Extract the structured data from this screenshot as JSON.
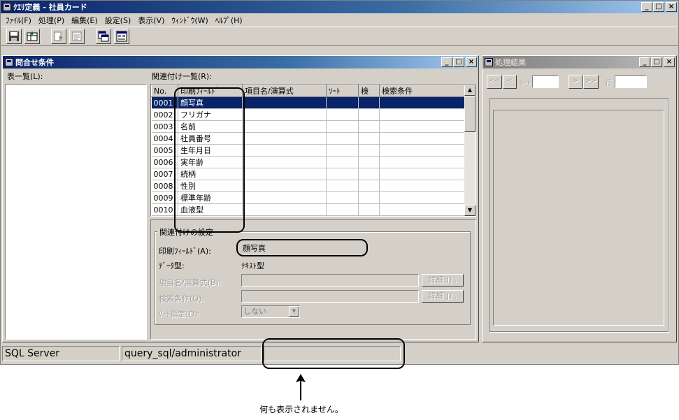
{
  "app": {
    "title": "ｸｴﾘ定義 - 社員カード",
    "menu": [
      "ﾌｧｲﾙ(F)",
      "処理(P)",
      "編集(E)",
      "設定(S)",
      "表示(V)",
      "ｳｨﾝﾄﾞｳ(W)",
      "ﾍﾙﾌﾟ(H)"
    ]
  },
  "query_window": {
    "title": "問合せ条件",
    "table_list_label": "表一覧(L):",
    "related_list_label": "関連付け一覧(R):",
    "columns": [
      "No.",
      "印刷ﾌｨｰﾙﾄﾞ",
      "項目名/演算式",
      "ｿｰﾄ",
      "検",
      "検索条件"
    ],
    "rows": [
      {
        "no": "0001",
        "field": "顔写真"
      },
      {
        "no": "0002",
        "field": "フリガナ"
      },
      {
        "no": "0003",
        "field": "名前"
      },
      {
        "no": "0004",
        "field": "社員番号"
      },
      {
        "no": "0005",
        "field": "生年月日"
      },
      {
        "no": "0006",
        "field": "実年齢"
      },
      {
        "no": "0007",
        "field": "続柄"
      },
      {
        "no": "0008",
        "field": "性別"
      },
      {
        "no": "0009",
        "field": "標準年齢"
      },
      {
        "no": "0010",
        "field": "血液型"
      }
    ],
    "settings": {
      "group_title": "関連付けの設定",
      "print_field_label": "印刷ﾌｨｰﾙﾄﾞ(A):",
      "print_field_value": "顔写真",
      "data_type_label": "ﾃﾞｰﾀ型:",
      "data_type_value": "ﾃｷｽﾄ型",
      "item_name_label": "項目名/演算式(B):",
      "search_cond_label": "検索条件(Q):",
      "sort_label": "ｿｰﾄ指定(D):",
      "sort_value": "しない",
      "detail_button_1": "詳細(I)..",
      "detail_button_2": "詳細(J).."
    }
  },
  "result_window": {
    "title": "処理結果",
    "nav_first": "<<",
    "nav_prev": "<",
    "sheet_label": "ｼｰﾄ",
    "nav_next": ">",
    "nav_last": ">>",
    "row_label": "行"
  },
  "status_bar": {
    "server": "SQL Server",
    "connection": "query_sql/administrator",
    "empty_panel": ""
  },
  "annotation": {
    "text": "何も表示されません。"
  }
}
